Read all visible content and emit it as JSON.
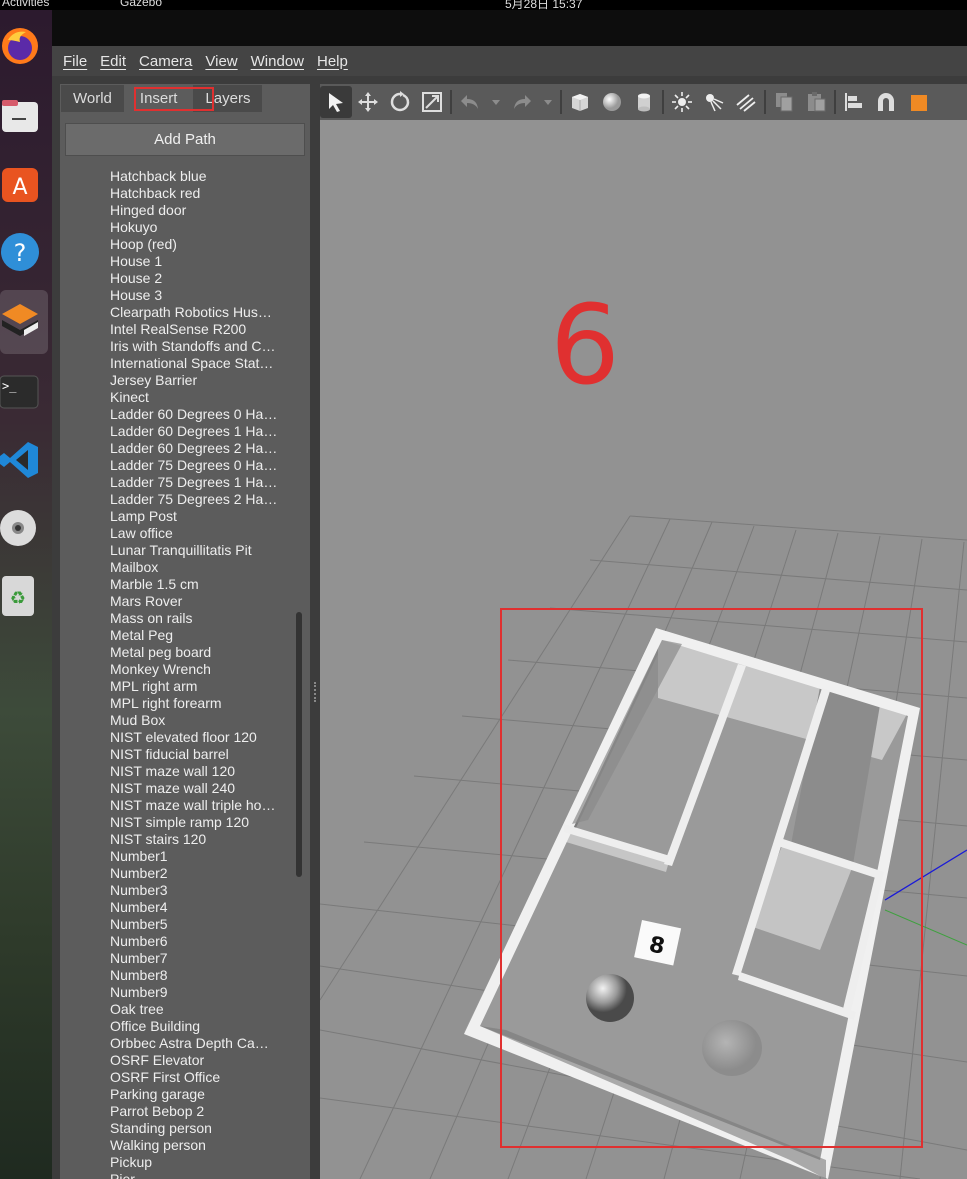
{
  "system_bar": {
    "activities_label": "Activities",
    "app_name": "Gazebo",
    "clock": "5月28日 15:37"
  },
  "menu": {
    "items": [
      "File",
      "Edit",
      "Camera",
      "View",
      "Window",
      "Help"
    ]
  },
  "left_panel": {
    "tabs": [
      "World",
      "Insert",
      "Layers"
    ],
    "active_tab": "Insert",
    "add_path_label": "Add Path",
    "models": [
      "Hatchback blue",
      "Hatchback red",
      "Hinged door",
      "Hokuyo",
      "Hoop (red)",
      "House 1",
      "House 2",
      "House 3",
      "Clearpath Robotics Hus…",
      "Intel RealSense R200",
      "Iris with Standoffs and C…",
      "International Space Stat…",
      "Jersey Barrier",
      "Kinect",
      "Ladder 60 Degrees 0 Ha…",
      "Ladder 60 Degrees 1 Ha…",
      "Ladder 60 Degrees 2 Ha…",
      "Ladder 75 Degrees 0 Ha…",
      "Ladder 75 Degrees 1 Ha…",
      "Ladder 75 Degrees 2 Ha…",
      "Lamp Post",
      "Law office",
      "Lunar Tranquillitatis Pit",
      "Mailbox",
      "Marble 1.5 cm",
      "Mars Rover",
      "Mass on rails",
      "Metal Peg",
      "Metal peg board",
      "Monkey Wrench",
      "MPL right arm",
      "MPL right forearm",
      "Mud Box",
      "NIST elevated floor 120",
      "NIST fiducial barrel",
      "NIST maze wall 120",
      "NIST maze wall 240",
      "NIST maze wall triple ho…",
      "NIST simple ramp 120",
      "NIST stairs 120",
      "Number1",
      "Number2",
      "Number3",
      "Number4",
      "Number5",
      "Number6",
      "Number7",
      "Number8",
      "Number9",
      "Oak tree",
      "Office Building",
      "Orbbec Astra Depth Ca…",
      "OSRF Elevator",
      "OSRF First Office",
      "Parking garage",
      "Parrot Bebop 2",
      "Standing person",
      "Walking person",
      "Pickup",
      "Pier"
    ]
  },
  "toolbar": {
    "tools": [
      "select-arrow",
      "translate",
      "rotate",
      "scale",
      "undo",
      "redo",
      "box",
      "sphere",
      "cylinder",
      "point-light",
      "spot-light",
      "directional-light",
      "copy",
      "paste",
      "align",
      "snap",
      "change-view"
    ]
  },
  "viewport": {
    "overlay_number": "6",
    "cube_label": "8"
  },
  "colors": {
    "highlight": "#e03030",
    "viewport_bg": "#929292",
    "panel_bg": "#5c5c5c"
  }
}
